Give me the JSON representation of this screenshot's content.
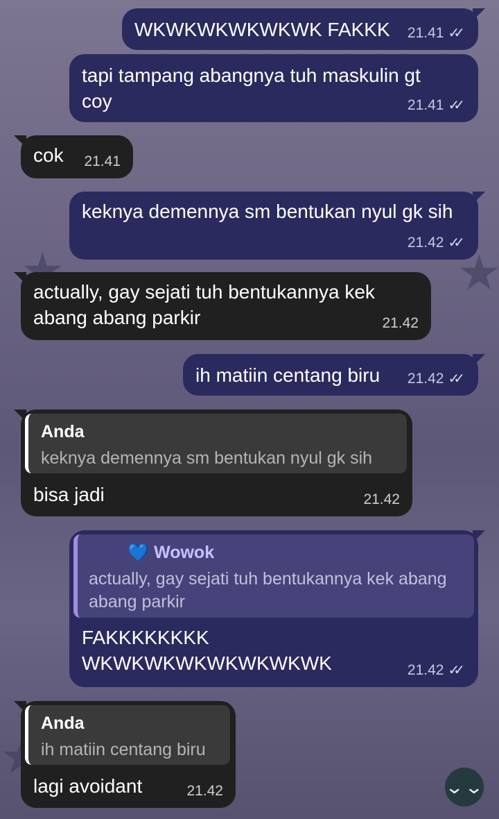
{
  "chat": {
    "messages": [
      {
        "text": "WKWKWKWKWKWK FAKKK",
        "time": "21.41",
        "ticks": "✓✓"
      },
      {
        "text": "tapi tampang abangnya tuh maskulin gt coy",
        "time": "21.41",
        "ticks": "✓✓"
      },
      {
        "text": "cok",
        "time": "21.41"
      },
      {
        "text": "keknya demennya sm bentukan nyul gk sih",
        "time": "21.42",
        "ticks": "✓✓"
      },
      {
        "text": "actually, gay sejati tuh bentukannya kek abang abang parkir",
        "time": "21.42"
      },
      {
        "text": "ih matiin centang biru",
        "time": "21.42",
        "ticks": "✓✓"
      },
      {
        "reply_name": "Anda",
        "reply_text": "keknya demennya sm bentukan nyul gk sih",
        "text": "bisa jadi",
        "time": "21.42"
      },
      {
        "reply_name": "💙 Wowok",
        "reply_text": "actually, gay sejati tuh bentukannya kek abang abang parkir",
        "text": "FAKKKKKKKK WKWKWKWKWKWKWKWK",
        "time": "21.42",
        "ticks": "✓✓"
      },
      {
        "reply_name": "Anda",
        "reply_text": "ih matiin centang biru",
        "text": "lagi avoidant",
        "time": "21.42"
      }
    ],
    "scroll_down_icon": "⌄⌄"
  }
}
